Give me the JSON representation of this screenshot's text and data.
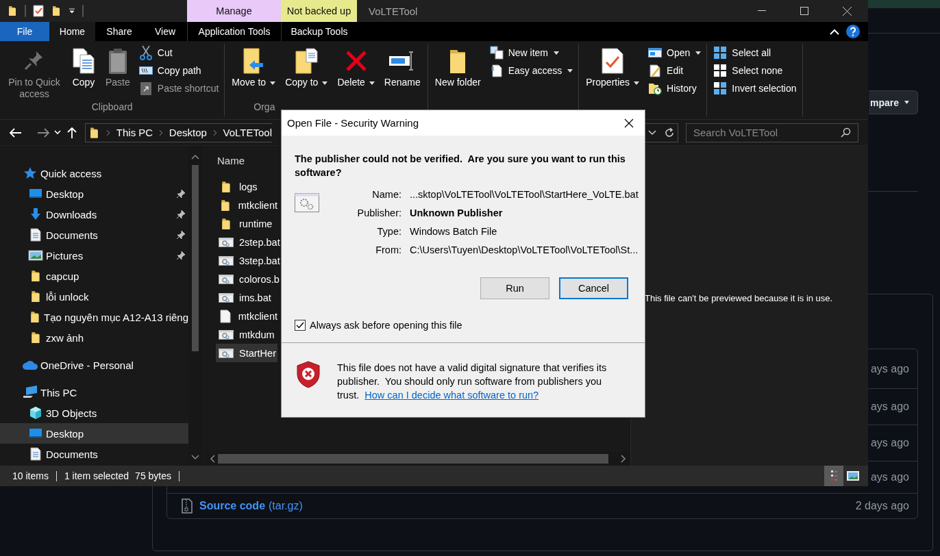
{
  "background_page": {
    "compare_button": "mpare",
    "assets": [
      {
        "time": "ays ago"
      },
      {
        "time": "ays ago"
      },
      {
        "time": "ays ago"
      },
      {
        "time": "ays ago"
      },
      {
        "name": "Source code",
        "detail": "(tar.gz)",
        "time": "2 days ago"
      }
    ]
  },
  "explorer": {
    "title": "VoLTETool",
    "tab_groups": [
      {
        "label": "Manage",
        "color": "#e8c9f7"
      },
      {
        "label": "Not backed up",
        "color": "#e7e98d"
      }
    ],
    "tabs": [
      {
        "label": "File",
        "kind": "file",
        "selected": false
      },
      {
        "label": "Home",
        "kind": "normal",
        "selected": true
      },
      {
        "label": "Share",
        "kind": "normal",
        "selected": false
      },
      {
        "label": "View",
        "kind": "normal",
        "selected": false
      },
      {
        "label": "Application Tools",
        "kind": "context",
        "selected": false
      },
      {
        "label": "Backup Tools",
        "kind": "context",
        "selected": false
      }
    ],
    "ribbon": [
      {
        "label": "Clipboard",
        "items": [
          {
            "label": "Pin to Quick access",
            "kind": "large",
            "disabled": true,
            "dropdown": false
          },
          {
            "label": "Copy",
            "kind": "large",
            "disabled": false,
            "dropdown": false
          },
          {
            "label": "Paste",
            "kind": "large",
            "disabled": true,
            "dropdown": false
          },
          {
            "label": "Cut",
            "kind": "small",
            "disabled": false,
            "dropdown": false
          },
          {
            "label": "Copy path",
            "kind": "small",
            "disabled": false,
            "dropdown": false
          },
          {
            "label": "Paste shortcut",
            "kind": "small",
            "disabled": true,
            "dropdown": false
          }
        ]
      },
      {
        "label": "Orga",
        "items": [
          {
            "label": "Move to",
            "kind": "large",
            "disabled": false,
            "dropdown": true
          },
          {
            "label": "Copy to",
            "kind": "large",
            "disabled": false,
            "dropdown": true
          },
          {
            "label": "Delete",
            "kind": "large",
            "disabled": false,
            "dropdown": true
          },
          {
            "label": "Rename",
            "kind": "large",
            "disabled": false,
            "dropdown": false
          }
        ]
      },
      {
        "items": [
          {
            "label": "New folder",
            "kind": "large",
            "disabled": false,
            "dropdown": false
          },
          {
            "label": "New item",
            "kind": "small",
            "disabled": false,
            "dropdown": true
          },
          {
            "label": "Easy access",
            "kind": "small",
            "disabled": false,
            "dropdown": true
          }
        ]
      },
      {
        "items": [
          {
            "label": "Properties",
            "kind": "large",
            "disabled": false,
            "dropdown": true
          },
          {
            "label": "Open",
            "kind": "small",
            "disabled": false,
            "dropdown": true
          },
          {
            "label": "Edit",
            "kind": "small",
            "disabled": false,
            "dropdown": false
          },
          {
            "label": "History",
            "kind": "small",
            "disabled": false,
            "dropdown": false
          }
        ]
      },
      {
        "items": [
          {
            "label": "Select all",
            "kind": "small",
            "disabled": false,
            "dropdown": false
          },
          {
            "label": "Select none",
            "kind": "small",
            "disabled": false,
            "dropdown": false
          },
          {
            "label": "Invert selection",
            "kind": "small",
            "disabled": false,
            "dropdown": false
          }
        ]
      }
    ],
    "address": {
      "crumbs": [
        "This PC",
        "Desktop",
        "VoLTETool"
      ],
      "search_placeholder": "Search VoLTETool"
    },
    "navigation": [
      {
        "label": "Quick access",
        "kind": "star",
        "selected": false,
        "children": [
          {
            "label": "Desktop",
            "kind": "desktop",
            "pinned": true,
            "selected": false
          },
          {
            "label": "Downloads",
            "kind": "download",
            "pinned": true,
            "selected": false
          },
          {
            "label": "Documents",
            "kind": "document",
            "pinned": true,
            "selected": false
          },
          {
            "label": "Pictures",
            "kind": "pictures",
            "pinned": true,
            "selected": false
          },
          {
            "label": "capcup",
            "kind": "folder",
            "pinned": false,
            "selected": false
          },
          {
            "label": "lỗi unlock",
            "kind": "folder",
            "pinned": false,
            "selected": false
          },
          {
            "label": "Tạo nguyên mục A12-A13 riêng",
            "kind": "folder",
            "pinned": false,
            "selected": false
          },
          {
            "label": "zxw ảnh",
            "kind": "folder",
            "pinned": false,
            "selected": false
          }
        ]
      },
      {
        "label": "OneDrive - Personal",
        "kind": "cloud",
        "selected": false
      },
      {
        "label": "This PC",
        "kind": "pc",
        "selected": false,
        "children": [
          {
            "label": "3D Objects",
            "kind": "cube",
            "pinned": false,
            "selected": false
          },
          {
            "label": "Desktop",
            "kind": "desktop",
            "pinned": false,
            "selected": true
          },
          {
            "label": "Documents",
            "kind": "document",
            "pinned": false,
            "selected": false
          }
        ]
      }
    ],
    "files": {
      "column": "Name",
      "items": [
        {
          "name": "logs",
          "kind": "folder",
          "selected": false
        },
        {
          "name": "mtkclient",
          "kind": "folder",
          "selected": false
        },
        {
          "name": "runtime",
          "kind": "folder",
          "selected": false
        },
        {
          "name": "2step.bat",
          "kind": "batch",
          "selected": false
        },
        {
          "name": "3step.bat",
          "kind": "batch",
          "selected": false
        },
        {
          "name": "coloros.b",
          "kind": "batch",
          "selected": false
        },
        {
          "name": "ims.bat",
          "kind": "batch",
          "selected": false
        },
        {
          "name": "mtkclient",
          "kind": "file",
          "selected": false
        },
        {
          "name": "mtkdum",
          "kind": "batch",
          "selected": false
        },
        {
          "name": "StartHer",
          "kind": "batch",
          "selected": true
        }
      ]
    },
    "preview_message": "This file can't be previewed because it is in use.",
    "status_bar": {
      "item_count": "10 items",
      "selection": "1 item selected",
      "size": "75 bytes"
    },
    "view_buttons": [
      {
        "selected": true
      },
      {
        "selected": false
      }
    ]
  },
  "dialog": {
    "title": "Open File - Security Warning",
    "heading": "The publisher could not be verified.  Are you sure you want to run this software?",
    "fields": [
      {
        "label": "Name:",
        "value": "...sktop\\VoLTETool\\VoLTETool\\StartHere_VoLTE.bat",
        "bold": false
      },
      {
        "label": "Publisher:",
        "value": "Unknown Publisher",
        "bold": true
      },
      {
        "label": "Type:",
        "value": "Windows Batch File",
        "bold": false
      },
      {
        "label": "From:",
        "value": "C:\\Users\\Tuyen\\Desktop\\VoLTETool\\VoLTETool\\St...",
        "bold": false
      }
    ],
    "buttons": [
      {
        "label": "Run",
        "default": false
      },
      {
        "label": "Cancel",
        "default": true
      }
    ],
    "checkbox": {
      "label": "Always ask before opening this file",
      "checked": true
    },
    "warning": "This file does not have a valid digital signature that verifies its publisher.  You should only run software from publishers you trust.",
    "link": "How can I decide what software to run?"
  }
}
